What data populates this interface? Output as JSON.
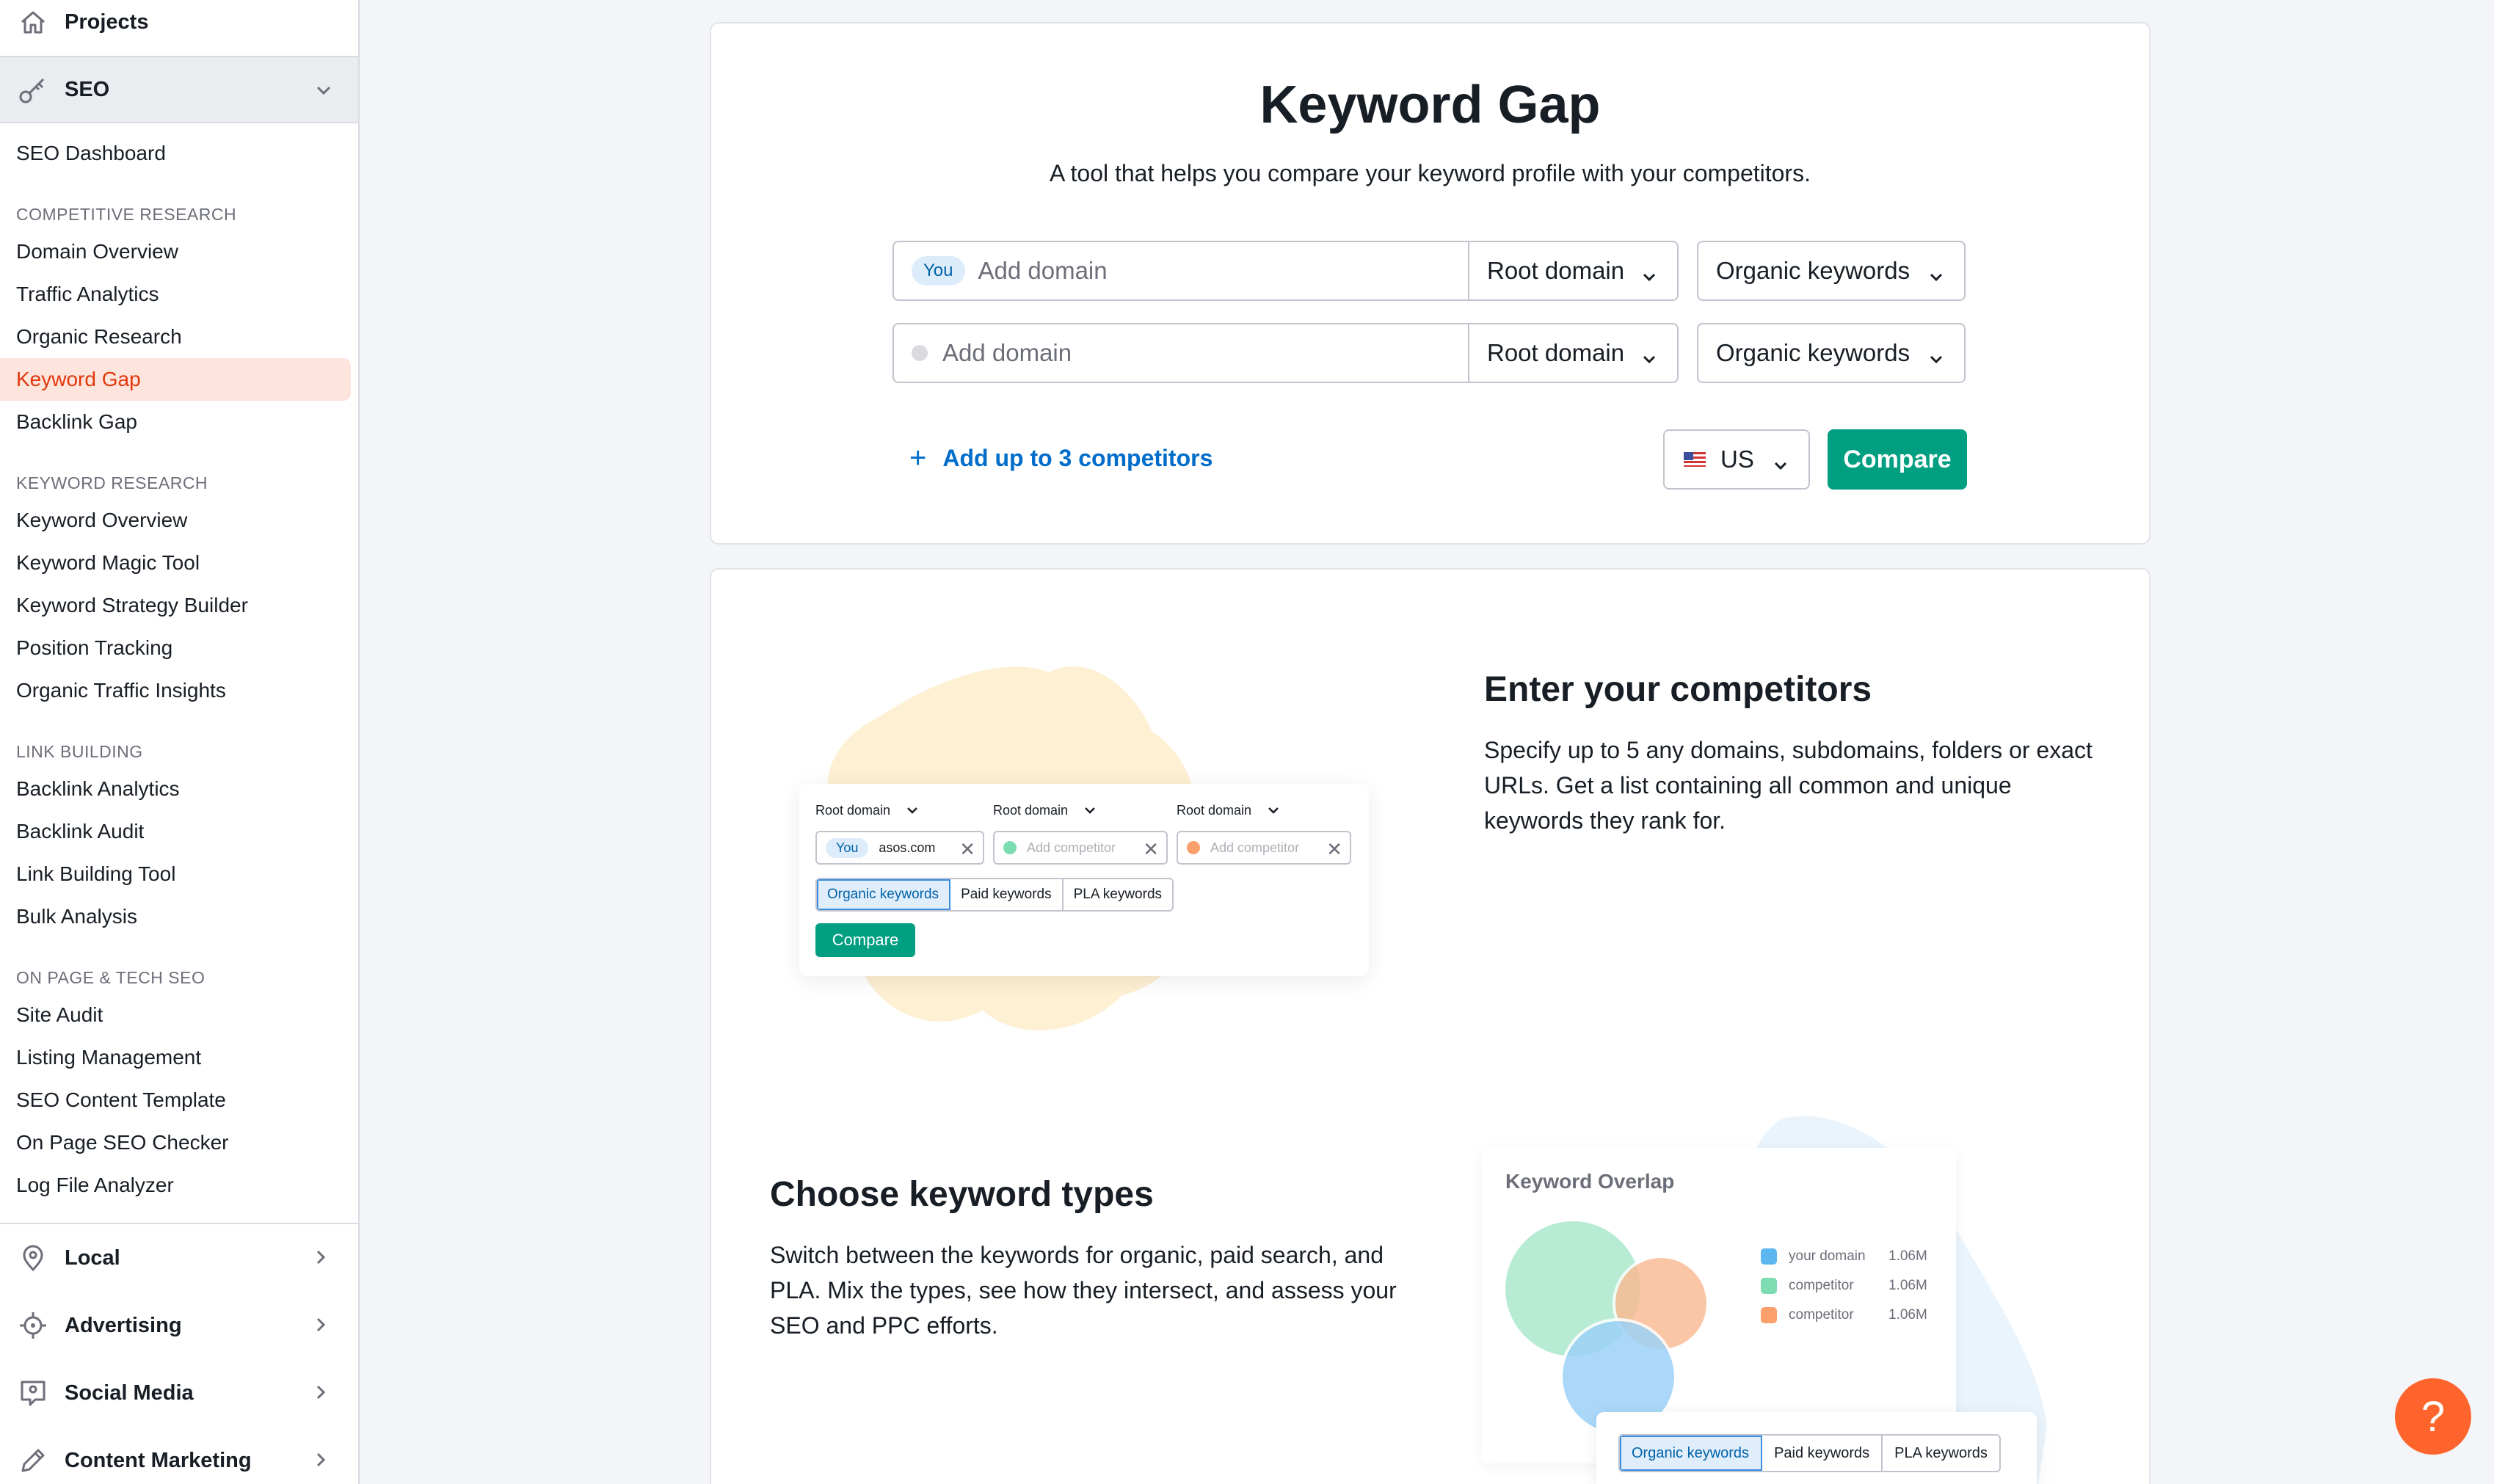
{
  "sidebar": {
    "projects_label": "Projects",
    "seo_label": "SEO",
    "seo_dashboard": "SEO Dashboard",
    "sections": [
      {
        "title": "COMPETITIVE RESEARCH",
        "items": [
          "Domain Overview",
          "Traffic Analytics",
          "Organic Research",
          "Keyword Gap",
          "Backlink Gap"
        ]
      },
      {
        "title": "KEYWORD RESEARCH",
        "items": [
          "Keyword Overview",
          "Keyword Magic Tool",
          "Keyword Strategy Builder",
          "Position Tracking",
          "Organic Traffic Insights"
        ]
      },
      {
        "title": "LINK BUILDING",
        "items": [
          "Backlink Analytics",
          "Backlink Audit",
          "Link Building Tool",
          "Bulk Analysis"
        ]
      },
      {
        "title": "ON PAGE & TECH SEO",
        "items": [
          "Site Audit",
          "Listing Management",
          "SEO Content Template",
          "On Page SEO Checker",
          "Log File Analyzer"
        ]
      }
    ],
    "active_item": "Keyword Gap",
    "groups": [
      "Local",
      "Advertising",
      "Social Media",
      "Content Marketing"
    ]
  },
  "header": {
    "title": "Keyword Gap",
    "subtitle": "A tool that helps you compare your keyword profile with your competitors."
  },
  "form": {
    "you_badge": "You",
    "domain_placeholder": "Add domain",
    "root_domain": "Root domain",
    "organic_keywords": "Organic keywords",
    "add_competitors": "Add up to 3 competitors",
    "add_icon": "plus-icon",
    "country": "US",
    "compare": "Compare"
  },
  "features": {
    "f1_title": "Enter your competitors",
    "f1_text": "Specify up to 5 any domains, subdomains, folders or exact URLs. Get a list containing all common and unique keywords they rank for.",
    "f2_title": "Choose keyword types",
    "f2_text": "Switch between the keywords for organic, paid search, and PLA. Mix the types, see how they intersect, and assess your SEO and PPC efforts."
  },
  "illustration1": {
    "root_domain": "Root domain",
    "you": "You",
    "domain_value": "asos.com",
    "add_competitor": "Add competitor",
    "tabs": [
      "Organic keywords",
      "Paid keywords",
      "PLA keywords"
    ],
    "compare": "Compare"
  },
  "illustration2": {
    "title": "Keyword Overlap",
    "legend": [
      {
        "name": "your domain",
        "value": "1.06M",
        "color": "#5db7f0"
      },
      {
        "name": "competitor",
        "value": "1.06M",
        "color": "#7ddcb1"
      },
      {
        "name": "competitor",
        "value": "1.06M",
        "color": "#fba06a"
      }
    ],
    "tabs": [
      "Organic keywords",
      "Paid keywords",
      "PLA keywords"
    ]
  },
  "help": "?",
  "colors": {
    "accent": "#009f81",
    "link": "#006dca",
    "active": "#e2380c",
    "help": "#ff642d"
  }
}
